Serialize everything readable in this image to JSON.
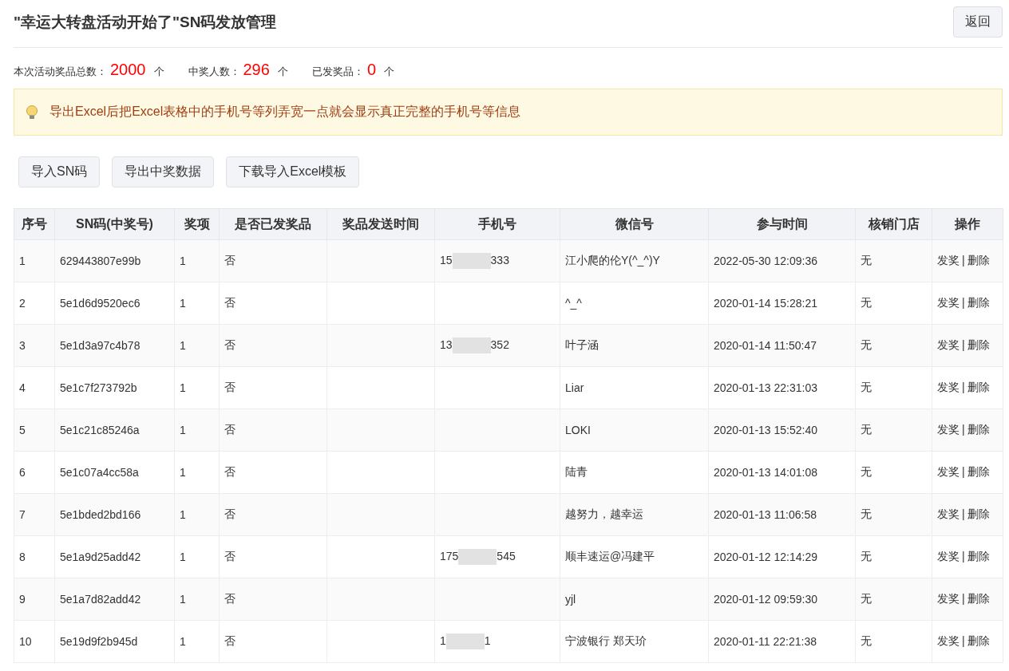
{
  "title": "\"幸运大转盘活动开始了\"SN码发放管理",
  "back_button": "返回",
  "stats": [
    {
      "label": "本次活动奖品总数：",
      "value": "2000",
      "unit": "个"
    },
    {
      "label": "中奖人数：",
      "value": "296",
      "unit": "个"
    },
    {
      "label": "已发奖品：",
      "value": "0",
      "unit": "个"
    }
  ],
  "notice": "导出Excel后把Excel表格中的手机号等列弄宽一点就会显示真正完整的手机号等信息",
  "buttons": [
    "导入SN码",
    "导出中奖数据",
    "下载导入Excel模板"
  ],
  "table": {
    "columns": [
      "序号",
      "SN码(中奖号)",
      "奖项",
      "是否已发奖品",
      "奖品发送时间",
      "手机号",
      "微信号",
      "参与时间",
      "核销门店",
      "操作"
    ],
    "rows": [
      {
        "no": "1",
        "sn": "629443807e99b",
        "prize": "1",
        "sent": "否",
        "phone": {
          "start": "15",
          "end": "333"
        },
        "wechat": "江小爬的伦Y(^_^)Y",
        "time": "2022-05-30 12:09:36",
        "store": "无",
        "actions": [
          "发奖",
          "删除"
        ],
        "separator": "|"
      },
      {
        "no": "2",
        "sn": "5e1d6d9520ec6",
        "prize": "1",
        "sent": "否",
        "wechat": "^_^",
        "time": "2020-01-14 15:28:21",
        "store": "无",
        "actions": [
          "发奖",
          "删除"
        ],
        "separator": "|"
      },
      {
        "no": "3",
        "sn": "5e1d3a97c4b78",
        "prize": "1",
        "sent": "否",
        "phone": {
          "start": "13",
          "end": "352"
        },
        "wechat": "叶子涵",
        "time": "2020-01-14 11:50:47",
        "store": "无",
        "actions": [
          "发奖",
          "删除"
        ],
        "separator": "|"
      },
      {
        "no": "4",
        "sn": "5e1c7f273792b",
        "prize": "1",
        "sent": "否",
        "wechat": "Liar",
        "time": "2020-01-13 22:31:03",
        "store": "无",
        "actions": [
          "发奖",
          "删除"
        ],
        "separator": "|"
      },
      {
        "no": "5",
        "sn": "5e1c21c85246a",
        "prize": "1",
        "sent": "否",
        "wechat": "LOKI",
        "time": "2020-01-13 15:52:40",
        "store": "无",
        "actions": [
          "发奖",
          "删除"
        ],
        "separator": "|"
      },
      {
        "no": "6",
        "sn": "5e1c07a4cc58a",
        "prize": "1",
        "sent": "否",
        "wechat": "陆青",
        "time": "2020-01-13 14:01:08",
        "store": "无",
        "actions": [
          "发奖",
          "删除"
        ],
        "separator": "|"
      },
      {
        "no": "7",
        "sn": "5e1bded2bd166",
        "prize": "1",
        "sent": "否",
        "wechat": "越努力，越幸运",
        "time": "2020-01-13 11:06:58",
        "store": "无",
        "actions": [
          "发奖",
          "删除"
        ],
        "separator": "|"
      },
      {
        "no": "8",
        "sn": "5e1a9d25add42",
        "prize": "1",
        "sent": "否",
        "phone": {
          "start": "175",
          "end": "545"
        },
        "wechat": "顺丰速运@冯建平",
        "time": "2020-01-12 12:14:29",
        "store": "无",
        "actions": [
          "发奖",
          "删除"
        ],
        "separator": "|"
      },
      {
        "no": "9",
        "sn": "5e1a7d82add42",
        "prize": "1",
        "sent": "否",
        "wechat": "yjl",
        "time": "2020-01-12 09:59:30",
        "store": "无",
        "actions": [
          "发奖",
          "删除"
        ],
        "separator": "|"
      },
      {
        "no": "10",
        "sn": "5e19d9f2b945d",
        "prize": "1",
        "sent": "否",
        "phone": {
          "start": "1",
          "end": "1"
        },
        "wechat": "宁波银行 郑天玠",
        "time": "2020-01-11 22:21:38",
        "store": "无",
        "actions": [
          "发奖",
          "删除"
        ],
        "separator": "|"
      }
    ]
  }
}
